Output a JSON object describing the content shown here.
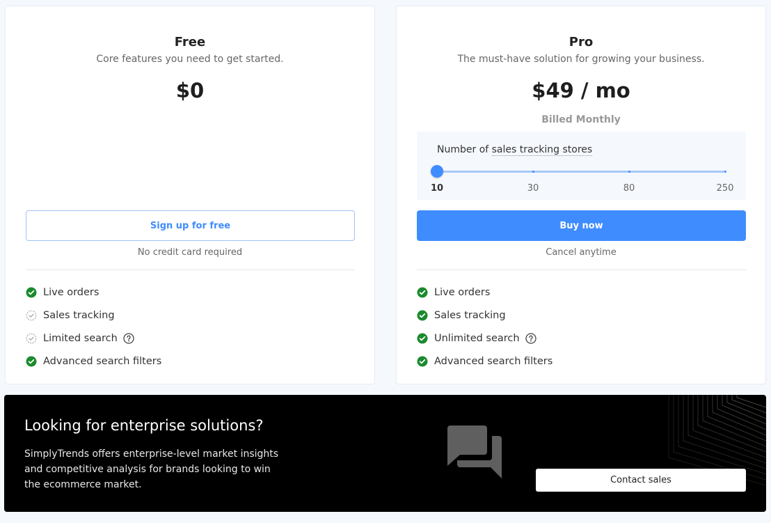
{
  "plans": {
    "free": {
      "name": "Free",
      "description": "Core features you need to get started.",
      "price": "$0",
      "cta_label": "Sign up for free",
      "cta_note": "No credit card required",
      "features": [
        {
          "label": "Live orders",
          "status": "included",
          "icon": "check-circle-icon"
        },
        {
          "label": "Sales tracking",
          "status": "limited",
          "icon": "dashed-check-circle-icon"
        },
        {
          "label": "Limited search",
          "status": "limited",
          "icon": "dashed-check-circle-icon",
          "help": true
        },
        {
          "label": "Advanced search filters",
          "status": "included",
          "icon": "check-circle-icon"
        }
      ]
    },
    "pro": {
      "name": "Pro",
      "description": "The must-have solution for growing your business.",
      "price": "$49 / mo",
      "billing": "Billed Monthly",
      "slider": {
        "label_prefix": "Number of ",
        "label_underlined": "sales tracking stores",
        "ticks": [
          "10",
          "30",
          "80",
          "250"
        ],
        "selected": "10"
      },
      "cta_label": "Buy now",
      "cta_note": "Cancel anytime",
      "features": [
        {
          "label": "Live orders",
          "status": "included",
          "icon": "check-circle-icon"
        },
        {
          "label": "Sales tracking",
          "status": "included",
          "icon": "check-circle-icon"
        },
        {
          "label": "Unlimited search",
          "status": "included",
          "icon": "check-circle-icon",
          "help": true
        },
        {
          "label": "Advanced search filters",
          "status": "included",
          "icon": "check-circle-icon"
        }
      ]
    }
  },
  "enterprise": {
    "title": "Looking for enterprise solutions?",
    "text": "SimplyTrends offers enterprise-level market insights and competitive analysis for brands looking to win the ecommerce market.",
    "icon": "chat-bubbles-icon",
    "button_label": "Contact sales"
  },
  "colors": {
    "accent": "#3f8cff",
    "check": "#1a8a2e",
    "banner_bg": "#000000"
  }
}
